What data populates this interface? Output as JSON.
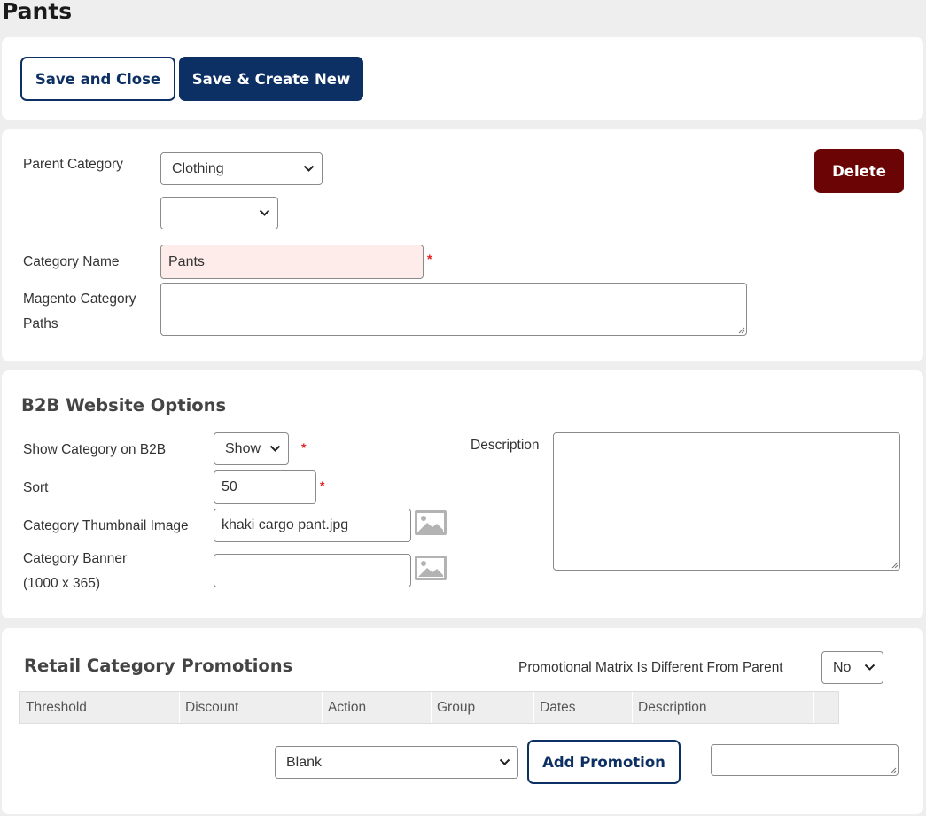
{
  "page": {
    "title": "Pants"
  },
  "toolbar": {
    "save_close_label": "Save and Close",
    "save_new_label": "Save & Create New"
  },
  "category": {
    "delete_label": "Delete",
    "parent_label": "Parent Category",
    "parent_value": "Clothing",
    "parent_sub_value": "",
    "name_label": "Category Name",
    "name_value": "Pants",
    "magento_label_1": "Magento Category",
    "magento_label_2": "Paths",
    "required_mark": "*"
  },
  "b2b": {
    "title": "B2B Website Options",
    "show_label": "Show Category on B2B",
    "show_value": "Show",
    "sort_label": "Sort",
    "sort_value": "50",
    "thumb_label": "Category Thumbnail Image",
    "thumb_value": "khaki cargo pant.jpg",
    "banner_label_1": "Category Banner",
    "banner_label_2": "(1000 x 365)",
    "banner_value": "",
    "description_label": "Description",
    "image_icon": "image-icon"
  },
  "promotions": {
    "title": "Retail Category Promotions",
    "matrix_label": "Promotional Matrix Is Different From Parent",
    "matrix_value": "No",
    "columns": [
      "Threshold",
      "Discount",
      "Action",
      "Group",
      "Dates",
      "Description"
    ],
    "new_type_value": "Blank",
    "add_label": "Add Promotion"
  },
  "colors": {
    "primary": "#0d3064",
    "danger": "#6b0505",
    "required_bg": "#fdecea",
    "required_star": "#e02020"
  }
}
